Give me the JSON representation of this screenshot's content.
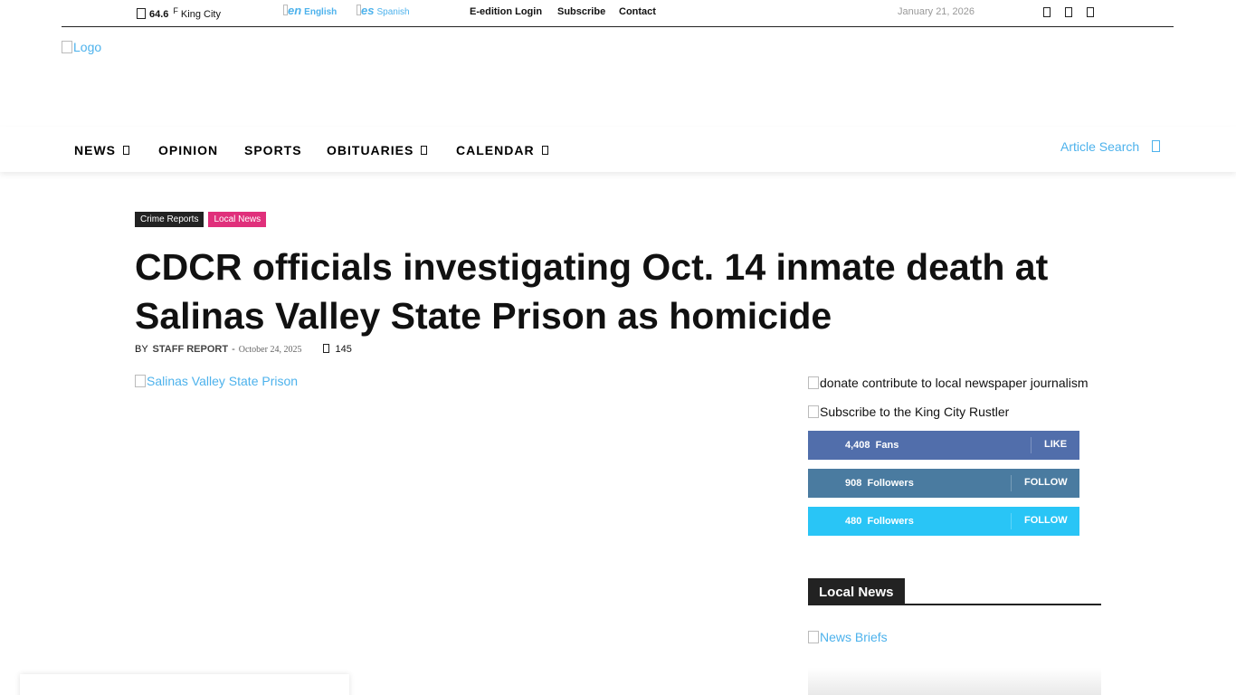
{
  "topbar": {
    "temperature": "64.6",
    "degree_symbol": "F",
    "location": "King City",
    "lang_en_code": "en",
    "lang_en_label": "English",
    "lang_es_code": "es",
    "lang_es_label": "Spanish",
    "links": [
      "E-edition Login",
      "Subscribe",
      "Contact"
    ],
    "date": "January 21, 2026"
  },
  "logo": {
    "alt": "Logo"
  },
  "nav": {
    "items": [
      "NEWS",
      "OPINION",
      "SPORTS",
      "OBITUARIES",
      "CALENDAR"
    ],
    "search_label": "Article Search"
  },
  "article": {
    "categories": [
      "Crime Reports",
      "Local News"
    ],
    "title": "CDCR officials investigating Oct. 14 inmate death at Salinas Valley State Prison as homicide",
    "by": "BY",
    "author": "STAFF REPORT",
    "date": "October 24, 2025",
    "comment_count": "145",
    "image_alt": "Salinas Valley State Prison"
  },
  "sidebar": {
    "donate_alt": "donate contribute to local newspaper journalism",
    "subscribe_alt": "Subscribe to the King City Rustler",
    "social": [
      {
        "count": "4,408",
        "unit": "Fans",
        "action": "LIKE",
        "color": "#516eab"
      },
      {
        "count": "908",
        "unit": "Followers",
        "action": "FOLLOW",
        "color": "#4a7ba0"
      },
      {
        "count": "480",
        "unit": "Followers",
        "action": "FOLLOW",
        "color": "#29c5f6"
      }
    ],
    "local_news_title": "Local News",
    "news_briefs_alt": "News Briefs"
  },
  "colors": {
    "accent": "#4db2ec",
    "category_pink": "#e0307b"
  }
}
